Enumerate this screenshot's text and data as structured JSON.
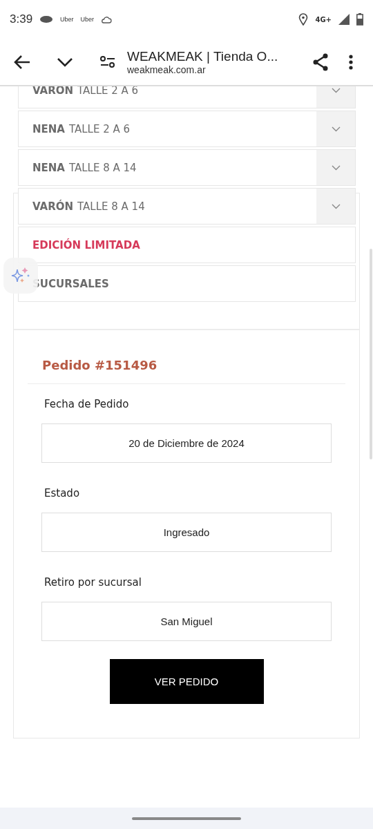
{
  "status_bar": {
    "time": "3:39",
    "notifications": [
      "Uber",
      "Uber"
    ],
    "network": "4G+"
  },
  "browser": {
    "title": "WEAKMEAK | Tienda O...",
    "url": "weakmeak.com.ar"
  },
  "menu": [
    {
      "kind": "dropdown",
      "bold": "VARON",
      "rest": "TALLE 2 A 6",
      "color": "#6b6b6b"
    },
    {
      "kind": "dropdown",
      "bold": "NENA",
      "rest": "TALLE 2 A 6",
      "color": "#6b6b6b"
    },
    {
      "kind": "dropdown",
      "bold": "NENA",
      "rest": "TALLE 8 A 14",
      "color": "#6b6b6b"
    },
    {
      "kind": "dropdown",
      "bold": "VARÓN",
      "rest": "TALLE 8 A 14",
      "color": "#6b6b6b"
    },
    {
      "kind": "link",
      "bold": "EDICIÓN LIMITADA",
      "color": "#d63a5a"
    },
    {
      "kind": "link",
      "bold": "SUCURSALES",
      "color": "#6b6b6b"
    }
  ],
  "order": {
    "title": "Pedido #151496",
    "fields": [
      {
        "label": "Fecha de Pedido",
        "value": "20 de Diciembre de 2024"
      },
      {
        "label": "Estado",
        "value": "Ingresado"
      },
      {
        "label": "Retiro por sucursal",
        "value": "San Miguel"
      }
    ],
    "button": "VER PEDIDO"
  }
}
